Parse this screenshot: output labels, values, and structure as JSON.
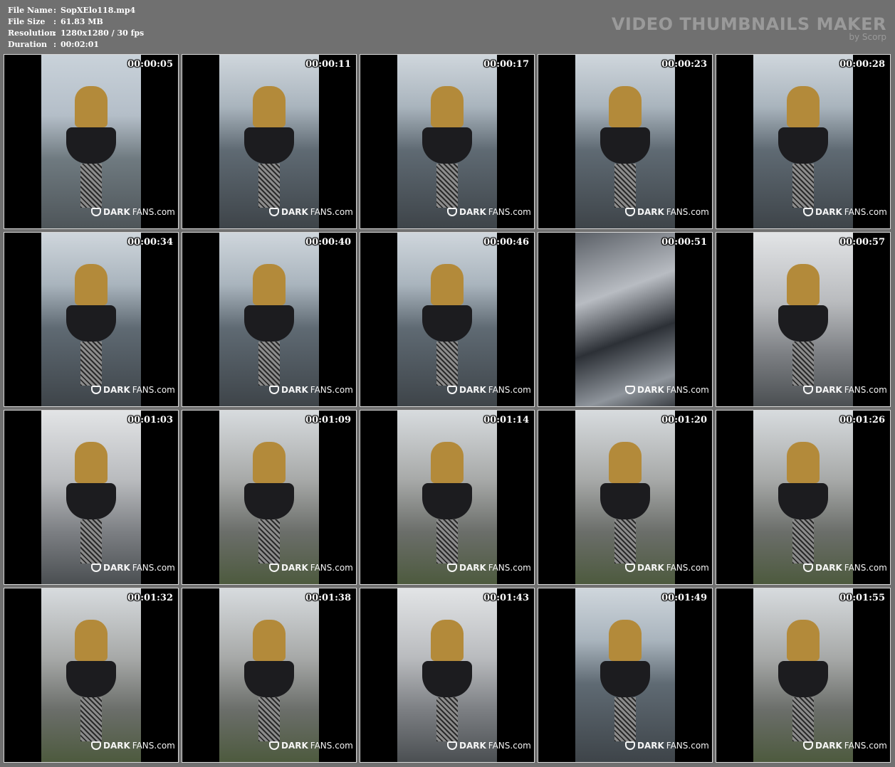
{
  "info": {
    "rows": [
      {
        "label": "File Name",
        "sep": ":",
        "value": "SopXElo118.mp4"
      },
      {
        "label": "File Size",
        "sep": ":",
        "value": "61.83 MB"
      },
      {
        "label": "Resolution",
        "sep": ":",
        "value": "1280x1280 / 30 fps"
      },
      {
        "label": "Duration",
        "sep": ":",
        "value": "00:02:01"
      }
    ]
  },
  "brand": {
    "title": "VIDEO THUMBNAILS MAKER",
    "subtitle": "by Scorp"
  },
  "watermark": {
    "part1": "DARK",
    "part2": "FANS.com"
  },
  "thumbnails": [
    "00:00:05",
    "00:00:11",
    "00:00:17",
    "00:00:23",
    "00:00:28",
    "00:00:34",
    "00:00:40",
    "00:00:46",
    "00:00:51",
    "00:00:57",
    "00:01:03",
    "00:01:09",
    "00:01:14",
    "00:01:20",
    "00:01:26",
    "00:01:32",
    "00:01:38",
    "00:01:43",
    "00:01:49",
    "00:01:55"
  ]
}
